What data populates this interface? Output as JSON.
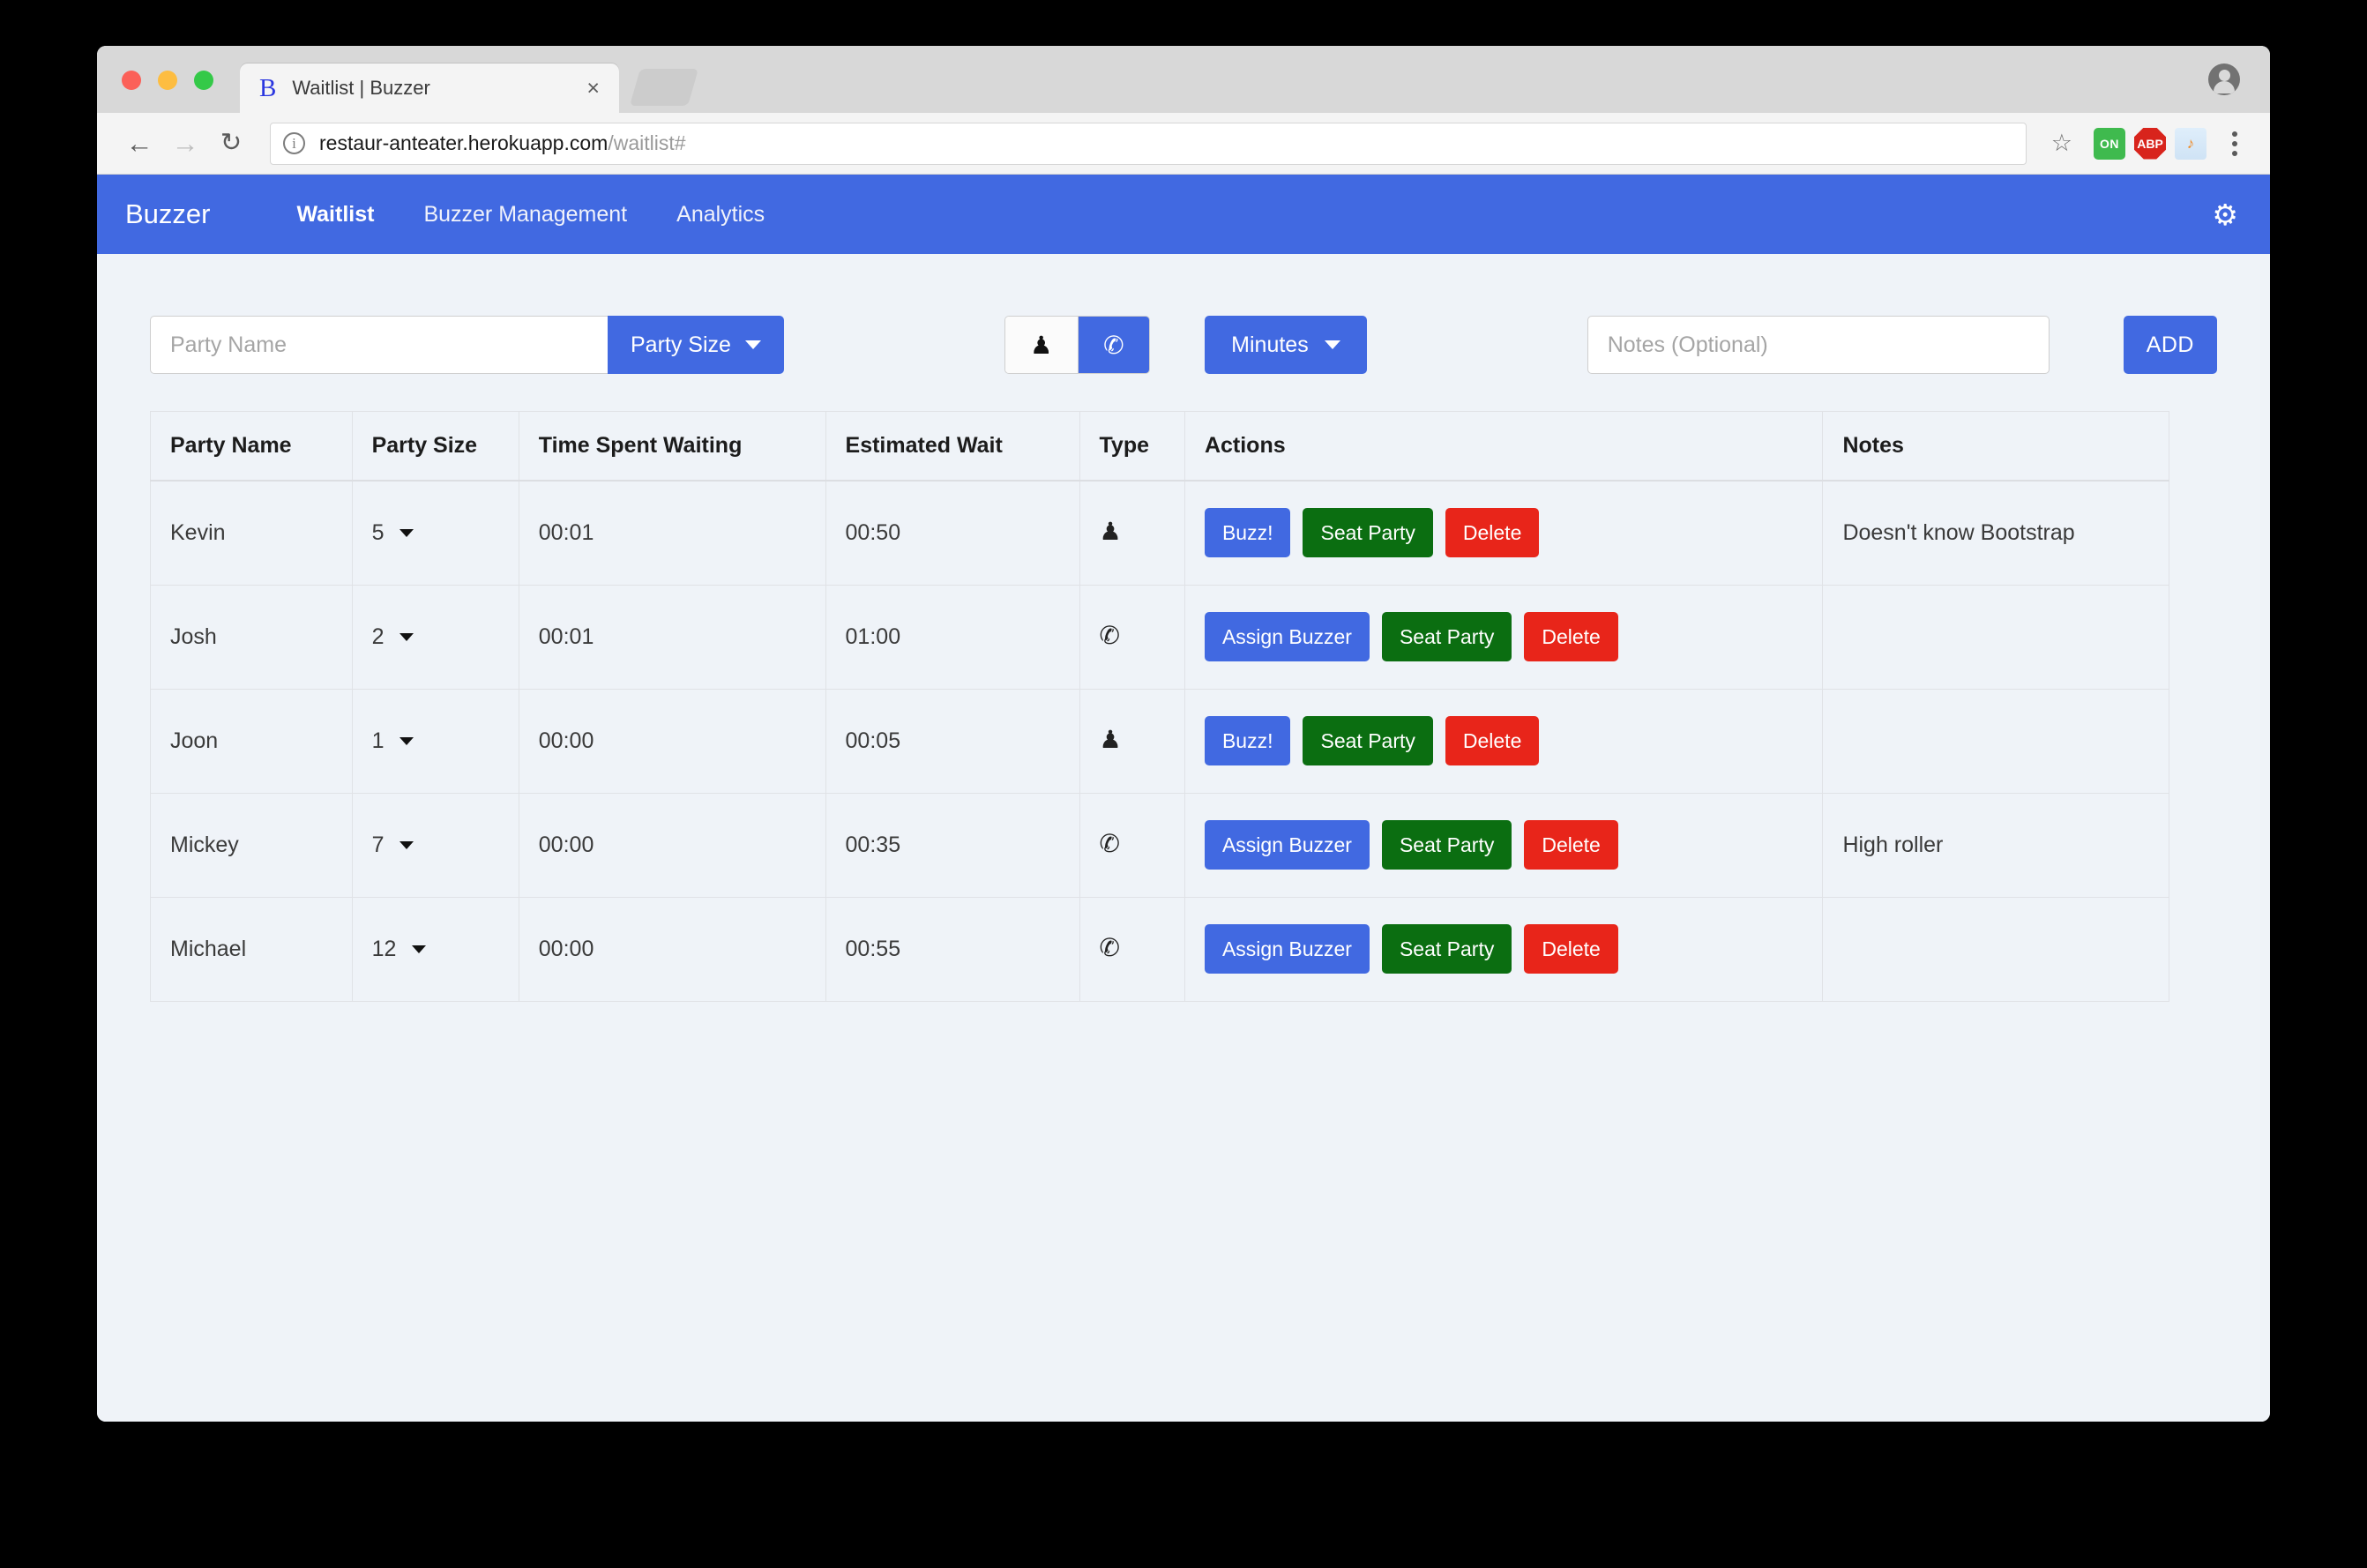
{
  "browser": {
    "tab": {
      "favicon": "B",
      "title": "Waitlist | Buzzer",
      "close": "×"
    },
    "nav": {
      "back": "←",
      "forward": "→",
      "reload": "↻"
    },
    "url": {
      "domain": "restaur-anteater.herokuapp.com",
      "path": "/waitlist#",
      "info_icon": "i"
    },
    "star": "☆",
    "extensions": [
      {
        "name": "on-badge-extension",
        "label": "ON"
      },
      {
        "name": "adblock-plus-extension",
        "label": "ABP"
      },
      {
        "name": "cloud-music-extension",
        "label": "♪"
      }
    ]
  },
  "navbar": {
    "brand": "Buzzer",
    "links": [
      {
        "label": "Waitlist",
        "active": true
      },
      {
        "label": "Buzzer Management",
        "active": false
      },
      {
        "label": "Analytics",
        "active": false
      }
    ],
    "settings_icon": "⚙"
  },
  "form": {
    "party_name_placeholder": "Party Name",
    "party_size_label": "Party Size",
    "type_toggle": {
      "person_icon": "♟",
      "phone_icon": "✆",
      "selected": "phone"
    },
    "minutes_label": "Minutes",
    "notes_placeholder": "Notes (Optional)",
    "add_label": "ADD"
  },
  "table": {
    "headers": [
      "Party Name",
      "Party Size",
      "Time Spent Waiting",
      "Estimated Wait",
      "Type",
      "Actions",
      "Notes"
    ],
    "rows": [
      {
        "party_name": "Kevin",
        "party_size": "5",
        "time_spent": "00:01",
        "estimated_wait": "00:50",
        "type": "person",
        "primary_action": "Buzz!",
        "seat_action": "Seat Party",
        "delete_action": "Delete",
        "notes": "Doesn't know Bootstrap"
      },
      {
        "party_name": "Josh",
        "party_size": "2",
        "time_spent": "00:01",
        "estimated_wait": "01:00",
        "type": "phone",
        "primary_action": "Assign Buzzer",
        "seat_action": "Seat Party",
        "delete_action": "Delete",
        "notes": ""
      },
      {
        "party_name": "Joon",
        "party_size": "1",
        "time_spent": "00:00",
        "estimated_wait": "00:05",
        "type": "person",
        "primary_action": "Buzz!",
        "seat_action": "Seat Party",
        "delete_action": "Delete",
        "notes": ""
      },
      {
        "party_name": "Mickey",
        "party_size": "7",
        "time_spent": "00:00",
        "estimated_wait": "00:35",
        "type": "phone",
        "primary_action": "Assign Buzzer",
        "seat_action": "Seat Party",
        "delete_action": "Delete",
        "notes": "High roller"
      },
      {
        "party_name": "Michael",
        "party_size": "12",
        "time_spent": "00:00",
        "estimated_wait": "00:55",
        "type": "phone",
        "primary_action": "Assign Buzzer",
        "seat_action": "Seat Party",
        "delete_action": "Delete",
        "notes": ""
      }
    ]
  },
  "colors": {
    "navbar_blue": "#4169e1",
    "button_blue": "#4169e1",
    "button_green": "#0b6e11",
    "button_red": "#e8251a",
    "page_background": "#eff3f8"
  }
}
